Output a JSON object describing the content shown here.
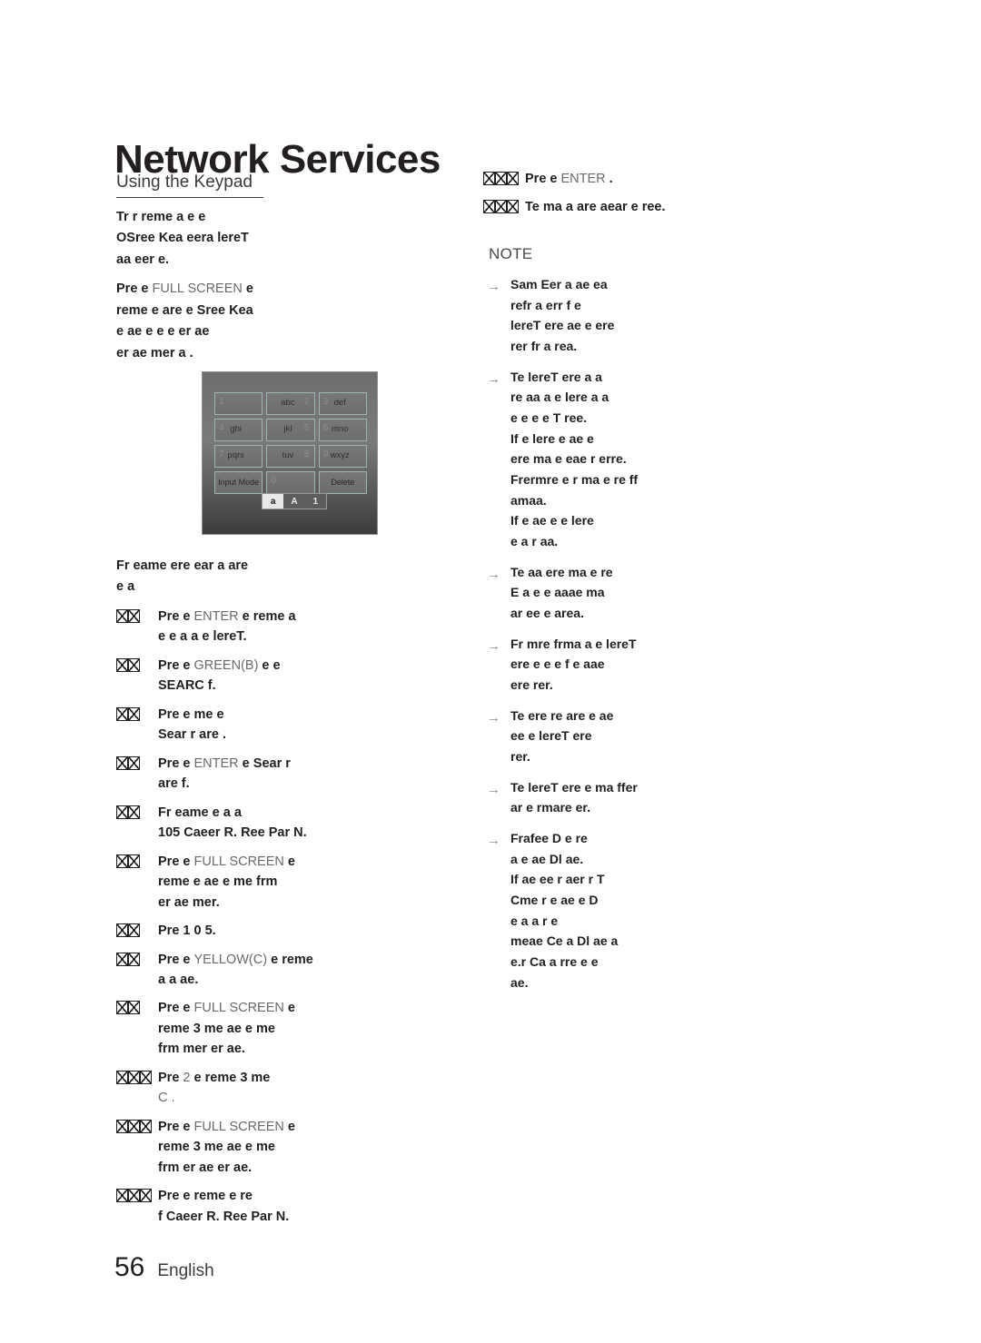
{
  "header": {
    "chapter_title": "Network Services",
    "section_title": "Using the Keypad"
  },
  "left_column": {
    "intro_paragraph_1": "Tr r reme  a e e",
    "intro_paragraph_2": "OSree Kea  eera lereT",
    "intro_paragraph_3": "aa  eer e.",
    "intro_press_prefix": "Pre e ",
    "intro_press_key": "FULL SCREEN",
    "intro_press_suffix": "  e",
    "intro_paragraph_4": "reme e  are  e Sree Kea",
    "intro_paragraph_5": "e  ae e e e  er ae",
    "intro_paragraph_6": "er ae mer a .",
    "subhead_1": "Fr eame ere   ear a are",
    "subhead_2": "e a",
    "steps": [
      {
        "marker_boxes": 2,
        "segments": [
          {
            "text": "Pre e ",
            "style": "bold"
          },
          {
            "text": "ENTER",
            "style": "light"
          },
          {
            "text": "  e reme a",
            "style": "bold"
          }
        ],
        "line2": "e e a  a e lereT."
      },
      {
        "marker_boxes": 2,
        "segments": [
          {
            "text": "Pre e ",
            "style": "bold"
          },
          {
            "text": "GREEN(B)",
            "style": "light"
          },
          {
            "text": "  e e",
            "style": "bold"
          }
        ],
        "line2": "SEARC f."
      },
      {
        "marker_boxes": 2,
        "segments": [
          {
            "text": "Pre e   me  e",
            "style": "bold"
          }
        ],
        "line2": "Sear r are ."
      },
      {
        "marker_boxes": 2,
        "segments": [
          {
            "text": "Pre e ",
            "style": "bold"
          },
          {
            "text": "ENTER",
            "style": "light"
          },
          {
            "text": "  e Sear r",
            "style": "bold"
          }
        ],
        "line2": "are f."
      },
      {
        "marker_boxes": 2,
        "segments": [
          {
            "text": "Fr eame e a  a",
            "style": "bold"
          }
        ],
        "line2": "105 Caeer R. Ree Par N."
      },
      {
        "marker_boxes": 2,
        "segments": [
          {
            "text": "Pre e ",
            "style": "bold"
          },
          {
            "text": "FULL SCREEN",
            "style": "light"
          },
          {
            "text": "  e",
            "style": "bold"
          }
        ],
        "line2": "reme e  ae e  me frm",
        "line3": "er ae  mer."
      },
      {
        "marker_boxes": 2,
        "segments": [
          {
            "text": "Pre 1 0 5.",
            "style": "bold"
          }
        ]
      },
      {
        "marker_boxes": 2,
        "segments": [
          {
            "text": "Pre e ",
            "style": "bold"
          },
          {
            "text": "YELLOW(C)",
            "style": "light"
          },
          {
            "text": "  e reme",
            "style": "bold"
          }
        ],
        "line2": " a a ae."
      },
      {
        "marker_boxes": 2,
        "segments": [
          {
            "text": "Pre e ",
            "style": "bold"
          },
          {
            "text": "FULL SCREEN",
            "style": "light"
          },
          {
            "text": "  e",
            "style": "bold"
          }
        ],
        "line2": "reme 3 me  ae e  me",
        "line3": "frm mer  er ae."
      },
      {
        "marker_boxes": 3,
        "segments": [
          {
            "text": "Pre ",
            "style": "bold"
          },
          {
            "text": "2",
            "style": "light"
          },
          {
            "text": "     e reme 3 me",
            "style": "bold"
          }
        ],
        "line2_light": " C        ."
      },
      {
        "marker_boxes": 3,
        "segments": [
          {
            "text": "Pre e ",
            "style": "bold"
          },
          {
            "text": "FULL SCREEN",
            "style": "light"
          },
          {
            "text": "  e",
            "style": "bold"
          }
        ],
        "line2": "reme 3 me  ae e  me",
        "line3": "frm er ae  er ae."
      },
      {
        "marker_boxes": 3,
        "segments": [
          {
            "text": "Pre  e reme  e re",
            "style": "bold"
          }
        ],
        "line2": "f Caeer R. Ree Par N."
      }
    ]
  },
  "keypad_figure": {
    "name": "on-screen-keypad",
    "keys": [
      {
        "number": "1",
        "letters": "",
        "num_side": "left"
      },
      {
        "number": "2",
        "letters": "abc",
        "num_side": "both"
      },
      {
        "number": "3",
        "letters": "def",
        "num_side": "none"
      },
      {
        "number": "4",
        "letters": "ghi",
        "num_side": "left"
      },
      {
        "number": "5",
        "letters": "jkl",
        "num_side": "both"
      },
      {
        "number": "6",
        "letters": "mno",
        "num_side": "none"
      },
      {
        "number": "7",
        "letters": "pqrs",
        "num_side": "left"
      },
      {
        "number": "8",
        "letters": "tuv",
        "num_side": "both"
      },
      {
        "number": "9",
        "letters": "wxyz",
        "num_side": "none"
      },
      {
        "number": "",
        "letters": "Input Mode",
        "num_side": "none"
      },
      {
        "number": "0",
        "letters": "",
        "num_side": "left"
      },
      {
        "number": "",
        "letters": "Delete",
        "num_side": "none"
      }
    ],
    "mode_toggle": {
      "options": [
        "a",
        "A",
        "1"
      ],
      "selected": "a"
    }
  },
  "right_column": {
    "steps": [
      {
        "marker_boxes": 3,
        "segments": [
          {
            "text": "Pre e ",
            "style": "bold"
          },
          {
            "text": "ENTER",
            "style": "light"
          },
          {
            "text": " .",
            "style": "bold"
          }
        ]
      },
      {
        "marker_boxes": 3,
        "segments": [
          {
            "text": "Te ma a are aear  e ree.",
            "style": "bold"
          }
        ]
      }
    ],
    "note_label": "NOTE",
    "notes": [
      {
        "lines": [
          "Sam Eer a ae  ea",
          "refr a err f e",
          "lereT ere ae  e ere",
          "rer fr a rea."
        ]
      },
      {
        "lines": [
          "Te lereT ere   a a",
          "re aa a e lere  a  a",
          "e e e  e T ree.",
          "If e lere e  ae e",
          "ere ma e eae r erre.",
          "Frermre e r ma e re ff",
          "amaa.",
          "If   e ae e e lere",
          "e a r aa."
        ]
      },
      {
        "lines": [
          "Te aa ere ma e re",
          "E  a e e aaae ma",
          "ar ee  e area."
        ]
      },
      {
        "lines": [
          "Fr mre frma a e lereT",
          "ere  e e e f e aae",
          "ere rer."
        ]
      },
      {
        "lines": [
          "Te ere re are e  ae",
          "ee  e lereT ere",
          "rer."
        ]
      },
      {
        "lines": [
          "Te lereT ere e ma ffer",
          "ar  e rmare er."
        ]
      },
      {
        "lines": [
          "Frafee D e  re",
          "a  e ae  Dl ae.",
          "If  ae ee r aer  r T",
          " Cme r e ae e D",
          "e a a   r e",
          "meae Ce  a Dl ae  a",
          " e.r Ca a rre e  e",
          "ae."
        ]
      }
    ]
  },
  "footer": {
    "page_number": "56",
    "language": "English"
  }
}
